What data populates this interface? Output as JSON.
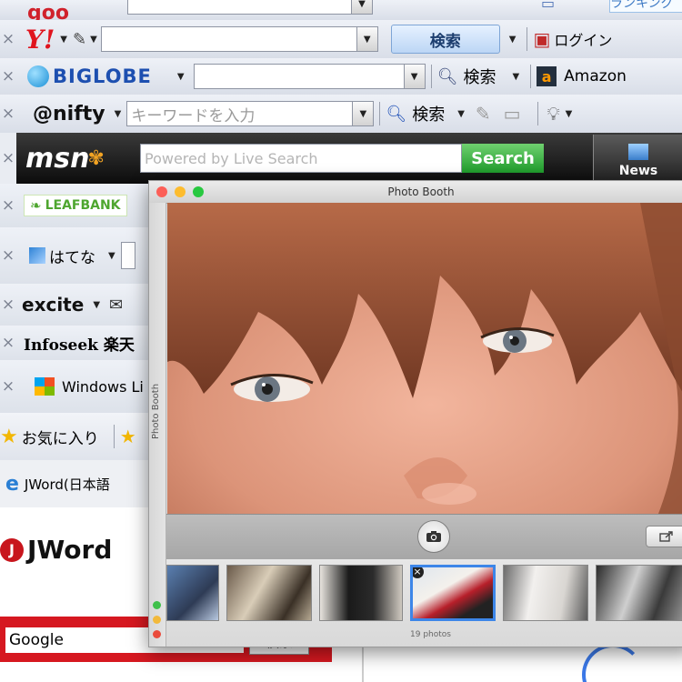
{
  "toolbars": {
    "goo": {
      "logo": "goo",
      "search_button": "ランキング"
    },
    "yahoo": {
      "logo": "Y!",
      "search_button": "検索",
      "login": "ログイン"
    },
    "biglobe": {
      "logo": "BIGLOBE",
      "search": "検索",
      "amazon": "Amazon"
    },
    "nifty": {
      "logo": "@nifty",
      "placeholder": "キーワードを入力",
      "search": "検索"
    },
    "msn": {
      "logo": "msn",
      "placeholder": "Powered by Live Search",
      "search_button": "Search",
      "news": "News"
    }
  },
  "sidebar": {
    "items": [
      {
        "label": "LEAFBANK"
      },
      {
        "label": "はてな"
      },
      {
        "label": "excite"
      },
      {
        "label": "Infoseek 楽天"
      },
      {
        "label": "Windows Li"
      },
      {
        "label": "お気に入り"
      },
      {
        "label": "JWord(日本語"
      }
    ]
  },
  "jword": {
    "logo": "JWord",
    "search_value": "Google",
    "search_button": "検索"
  },
  "photo_booth": {
    "title": "Photo Booth",
    "side_label": "Photo Booth",
    "photo_count": "19 photos",
    "thumbnails": [
      {
        "name": "thumb-1",
        "selected": false
      },
      {
        "name": "thumb-2",
        "selected": false
      },
      {
        "name": "thumb-3",
        "selected": false
      },
      {
        "name": "thumb-4",
        "selected": true
      },
      {
        "name": "thumb-5",
        "selected": false
      },
      {
        "name": "thumb-6",
        "selected": false
      }
    ]
  },
  "icons": {
    "shutter": "camera-icon",
    "share": "share-icon",
    "delete": "delete-icon",
    "close_light": "close-icon",
    "minimize_light": "minimize-icon",
    "zoom_light": "zoom-icon"
  }
}
